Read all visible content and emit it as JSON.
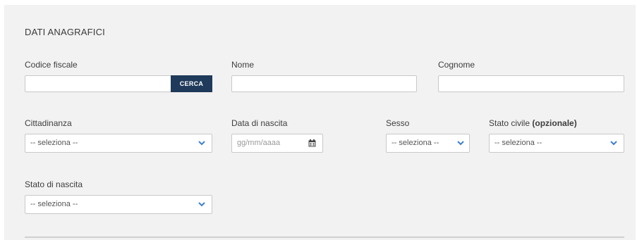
{
  "section": {
    "title": "DATI ANAGRAFICI"
  },
  "fields": {
    "codice_fiscale": {
      "label": "Codice fiscale",
      "value": "",
      "button": "CERCA"
    },
    "nome": {
      "label": "Nome",
      "value": ""
    },
    "cognome": {
      "label": "Cognome",
      "value": ""
    },
    "cittadinanza": {
      "label": "Cittadinanza",
      "selected": "-- seleziona --"
    },
    "data_nascita": {
      "label": "Data di nascita",
      "placeholder": "gg/mm/aaaa"
    },
    "sesso": {
      "label": "Sesso",
      "selected": "-- seleziona --"
    },
    "stato_civile": {
      "label": "Stato civile",
      "label_suffix": "(opzionale)",
      "selected": "-- seleziona --"
    },
    "stato_nascita": {
      "label": "Stato di nascita",
      "selected": "-- seleziona --"
    }
  },
  "icons": {
    "dropdown": "chevron-down-icon",
    "calendar": "calendar-icon"
  },
  "colors": {
    "accent": "#1f3a5a",
    "chevron": "#3b7fd0",
    "panel": "#f2f2f2"
  }
}
